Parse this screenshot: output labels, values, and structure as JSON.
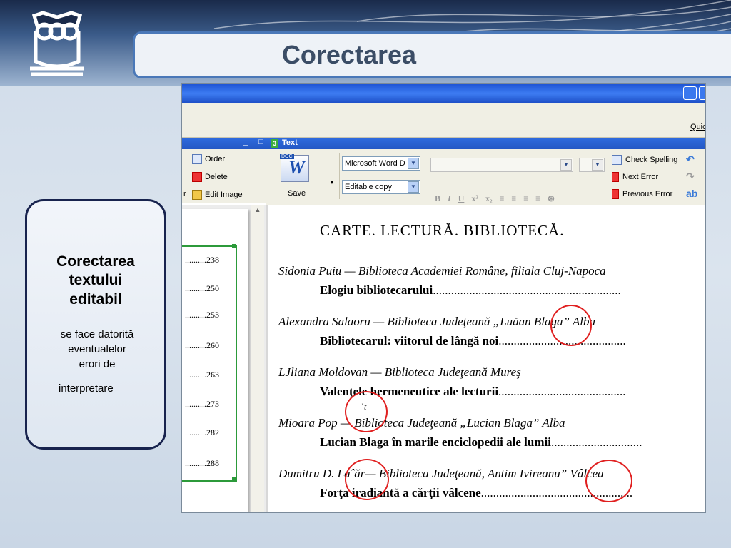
{
  "slide": {
    "title": "Corectarea",
    "note": {
      "heading_lines": [
        "Corectarea",
        "textului",
        "editabil"
      ],
      "body_lines": [
        "se face datorită",
        "eventualelor",
        "erori de"
      ],
      "tail": "interpretare"
    }
  },
  "window": {
    "menu_partial": "Quic",
    "left_panel": {
      "items": [
        {
          "label": "Order",
          "icon": "order-icon"
        },
        {
          "label": "Delete",
          "icon": "delete-icon"
        },
        {
          "label": "Edit Image",
          "icon": "edit-image-icon"
        }
      ],
      "left_fragment": "r",
      "toc": [
        "238",
        "250",
        "253",
        "260",
        "263",
        "273",
        "282",
        "288"
      ]
    },
    "text_panel": {
      "number": "3",
      "title": "Text",
      "save_label": "Save",
      "doc_tag": "DOC",
      "format_select": "Microsoft Word D",
      "mode_select": "Editable copy",
      "format_buttons": [
        "B",
        "I",
        "U",
        "x²",
        "x₂"
      ],
      "spell": [
        {
          "label": "Check Spelling",
          "icon": "check-spelling-icon"
        },
        {
          "label": "Next Error",
          "icon": "next-error-icon"
        },
        {
          "label": "Previous Error",
          "icon": "previous-error-icon"
        }
      ]
    },
    "document": {
      "heading": "CARTE. LECTURĂ. BIBLIOTECĂ.",
      "entries": [
        {
          "author": "Sidonia Puiu — Biblioteca Academiei Române, filiala Cluj-Napoca",
          "work": "Elogiu bibliotecarului"
        },
        {
          "author": "Alexandra Salaoru — Biblioteca Judeţeană „Luăan Blaga” Alba",
          "work": "Bibliotecarul: viitorul de lângă noi"
        },
        {
          "author": "LJliana Moldovan — Biblioteca Judeţeană Mureş",
          "work": "Valenţele hermeneutice ale lecturii"
        },
        {
          "author": "Mioara Pop — Biblioteca Judeţeană „Lucian Blaga” Alba",
          "work": "Lucian Blaga în marile enciclopedii ale lumii"
        },
        {
          "author": "Dumitru D. Laˆăr— Biblioteca Judeţeană, Antim Ivireanu” Vâlcea",
          "work": "Forţa iradiantă a cărţii vâlcene"
        }
      ],
      "error_marks": [
        "error-circle-luaan",
        "error-circle-valentele",
        "error-circle-lazar",
        "error-circle-ivireanu"
      ],
      "stray_mark": "ˋt"
    }
  },
  "colors": {
    "accent": "#4a78b8",
    "titlebar": "#2458c4",
    "error_circle": "#e02020",
    "toc_frame": "#2c9a3a"
  }
}
